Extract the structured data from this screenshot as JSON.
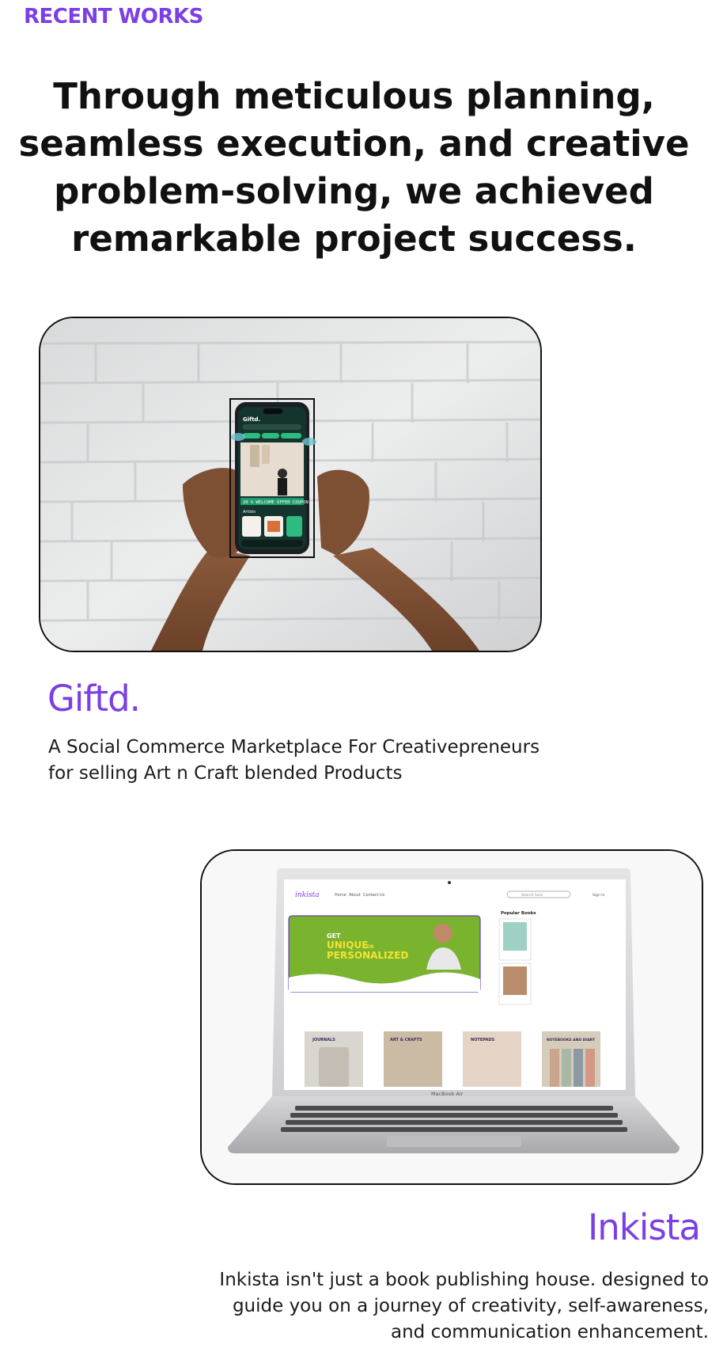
{
  "section_label": "RECENT WORKS",
  "headline": "Through meticulous planning, seamless execution, and creative problem-solving, we achieved remarkable project success.",
  "colors": {
    "accent": "#7b3fe4",
    "text": "#111111",
    "phone_green": "#1f9d6b",
    "inkista_green": "#7ab32e",
    "inkista_yellow": "#f3e332"
  },
  "projects": [
    {
      "title": "Giftd",
      "title_suffix": ".",
      "description": "A Social Commerce Marketplace For Creativepreneurs for selling  Art n Craft blended Products",
      "mockup": {
        "device": "phone-icon",
        "app_name": "Giftd.",
        "banner_text": "20 % WELCOME OFFER COUPON",
        "section_text": "Artists"
      }
    },
    {
      "title": "Inkista",
      "description": "Inkista isn't just a book publishing house. designed to guide you on a journey of creativity, self-awareness, and communication enhancement.",
      "mockup": {
        "device": "laptop-icon",
        "logo": "inkista",
        "nav": [
          "Home",
          "About",
          "Contact Us"
        ],
        "search_placeholder": "Search here",
        "sign_in": "Sign In",
        "hero_line1": "GET",
        "hero_line2": "UNIQUE",
        "hero_or": "OR",
        "hero_line3": "PERSONALIZED",
        "sidebar_title": "Popular Books",
        "categories": [
          "JOURNALS",
          "ART & CRAFTS",
          "NOTEPADS",
          "NOTEBOOKS AND DIARY"
        ],
        "laptop_brand": "MacBook Air"
      }
    }
  ]
}
